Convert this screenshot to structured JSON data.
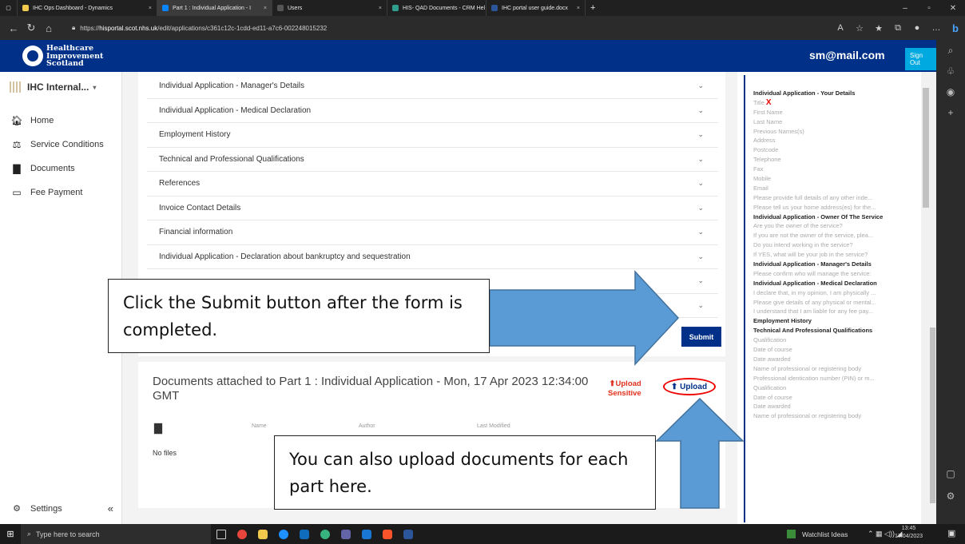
{
  "browser": {
    "tabs": [
      {
        "label": "IHC Ops Dashboard - Dynamics",
        "color": "#f2c94c"
      },
      {
        "label": "Part 1 : Individual Application - I",
        "color": "#0a84ff"
      },
      {
        "label": "Users",
        "color": "#555555"
      },
      {
        "label": "HIS- QAD Documents - CRM Hel",
        "color": "#2f9e8f"
      },
      {
        "label": "IHC portal user guide.docx",
        "color": "#2b579a"
      }
    ],
    "url_prefix": "https://",
    "url_host": "hisportal.scot.nhs.uk",
    "url_path": "/edit/applications/c361c12c-1cdd-ed11-a7c6-002248015232"
  },
  "header": {
    "logo_line1": "Healthcare",
    "logo_line2": "Improvement",
    "logo_line3": "Scotland",
    "user_email": "sm@mail.com",
    "sign_out": "Sign Out"
  },
  "sidebar": {
    "org": "IHC Internal...",
    "items": [
      {
        "label": "Home",
        "icon": "home-icon"
      },
      {
        "label": "Service Conditions",
        "icon": "gavel-icon"
      },
      {
        "label": "Documents",
        "icon": "document-icon"
      },
      {
        "label": "Fee Payment",
        "icon": "card-icon"
      }
    ],
    "settings": "Settings",
    "collapse": "«"
  },
  "form": {
    "sections": [
      "Individual Application - Manager's Details",
      "Individual Application - Medical Declaration",
      "Employment History",
      "Technical and Professional Qualifications",
      "References",
      "Invoice Contact Details",
      "Financial information",
      "Individual Application - Declaration about bankruptcy and sequestration",
      "",
      ""
    ],
    "submit": "Submit"
  },
  "documents": {
    "title": "Documents attached to Part 1 : Individual Application - Mon, 17 Apr 2023 12:34:00 GMT",
    "upload_sensitive_line1": "Upload",
    "upload_sensitive_line2": "Sensitive",
    "upload": "Upload",
    "col_name": "Name",
    "col_author": "Author",
    "col_modified": "Last Modified",
    "empty": "No files"
  },
  "callouts": {
    "submit": "Click the Submit button after the form is completed.",
    "upload": "You can also upload documents for each part here."
  },
  "details_panel": [
    {
      "text": "Individual Application - Your Details",
      "head": true
    },
    {
      "text": "Title",
      "required": "X"
    },
    {
      "text": "First Name"
    },
    {
      "text": "Last Name"
    },
    {
      "text": "Previous Names(s)"
    },
    {
      "text": "Address"
    },
    {
      "text": "Postcode"
    },
    {
      "text": "Telephone"
    },
    {
      "text": "Fax"
    },
    {
      "text": "Mobile"
    },
    {
      "text": "Email"
    },
    {
      "text": "Please provide full details of any other inde..."
    },
    {
      "text": "Please tell us your home address(es) for the..."
    },
    {
      "text": "Individual Application - Owner Of The Service",
      "head": true
    },
    {
      "text": "Are you the owner of the service?"
    },
    {
      "text": "If you are not the owner of the service, plea..."
    },
    {
      "text": "Do you intend working in the service?"
    },
    {
      "text": "If YES, what will be your job in the service?"
    },
    {
      "text": "Individual Application - Manager's Details",
      "head": true
    },
    {
      "text": "Please confirm who will manage the service:"
    },
    {
      "text": "Individual Application - Medical Declaration",
      "head": true
    },
    {
      "text": "I declare that, in my opinion, I am physically ..."
    },
    {
      "text": "Please give details of any physical or mental..."
    },
    {
      "text": "I understand that I am liable for any fee pay..."
    },
    {
      "text": "Employment History",
      "head": true
    },
    {
      "text": "Technical And Professional Qualifications",
      "head": true
    },
    {
      "text": "Qualification"
    },
    {
      "text": "Date of course"
    },
    {
      "text": "Date awarded"
    },
    {
      "text": "Name of professional or registering body"
    },
    {
      "text": "Professional identication number (PIN) or m..."
    },
    {
      "text": "Qualification"
    },
    {
      "text": "Date of course"
    },
    {
      "text": "Date awarded"
    },
    {
      "text": "Name of professional or registering body"
    }
  ],
  "taskbar": {
    "search_placeholder": "Type here to search",
    "watchlist": "Watchlist Ideas",
    "time": "13:45",
    "date": "17/04/2023"
  }
}
